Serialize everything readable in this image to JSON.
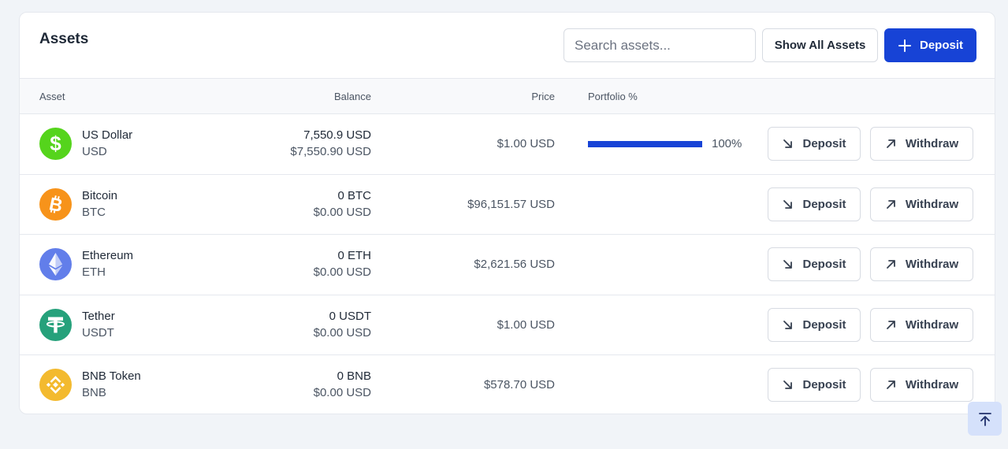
{
  "header": {
    "title": "Assets",
    "search_placeholder": "Search assets...",
    "search_value": "",
    "show_all_label": "Show All Assets",
    "deposit_label": "Deposit"
  },
  "table": {
    "columns": {
      "asset": "Asset",
      "balance": "Balance",
      "price": "Price",
      "portfolio": "Portfolio %"
    },
    "rows": [
      {
        "name": "US Dollar",
        "symbol": "USD",
        "balance": "7,550.9 USD",
        "balance_usd": "$7,550.90 USD",
        "price": "$1.00 USD",
        "portfolio_pct": "100%",
        "portfolio_fraction": 1.0,
        "deposit_label": "Deposit",
        "withdraw_label": "Withdraw",
        "icon": "dollar-icon",
        "icon_color": "#55d41c"
      },
      {
        "name": "Bitcoin",
        "symbol": "BTC",
        "balance": "0 BTC",
        "balance_usd": "$0.00 USD",
        "price": "$96,151.57 USD",
        "deposit_label": "Deposit",
        "withdraw_label": "Withdraw",
        "icon": "bitcoin-icon",
        "icon_color": "#f7931a"
      },
      {
        "name": "Ethereum",
        "symbol": "ETH",
        "balance": "0 ETH",
        "balance_usd": "$0.00 USD",
        "price": "$2,621.56 USD",
        "deposit_label": "Deposit",
        "withdraw_label": "Withdraw",
        "icon": "ethereum-icon",
        "icon_color": "#627eea"
      },
      {
        "name": "Tether",
        "symbol": "USDT",
        "balance": "0 USDT",
        "balance_usd": "$0.00 USD",
        "price": "$1.00 USD",
        "deposit_label": "Deposit",
        "withdraw_label": "Withdraw",
        "icon": "tether-icon",
        "icon_color": "#26a17b"
      },
      {
        "name": "BNB Token",
        "symbol": "BNB",
        "balance": "0 BNB",
        "balance_usd": "$0.00 USD",
        "price": "$578.70 USD",
        "deposit_label": "Deposit",
        "withdraw_label": "Withdraw",
        "icon": "bnb-icon",
        "icon_color": "#f3ba2f"
      }
    ]
  },
  "colors": {
    "accent": "#1743d6",
    "page_bg": "#f1f4f8",
    "scroll_top_bg": "#d5e1fb"
  },
  "scroll_top_icon": "arrow-up-to-line-icon"
}
